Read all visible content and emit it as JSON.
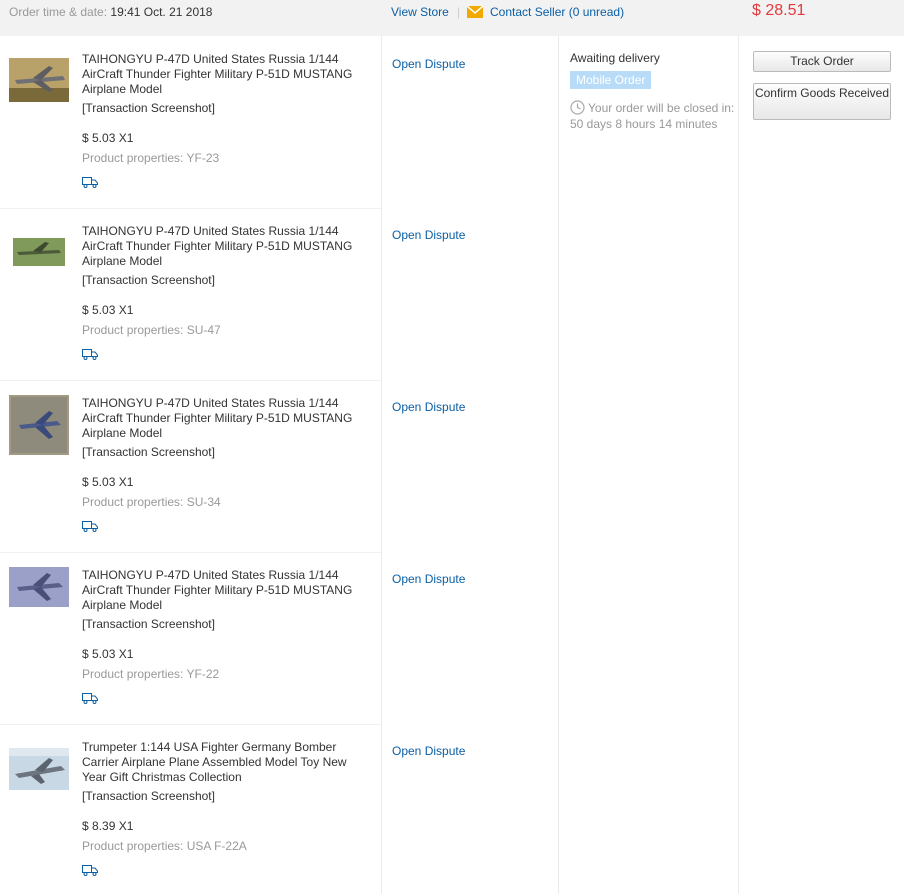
{
  "header": {
    "order_time_label": "Order time & date:",
    "order_time_value": "19:41 Oct. 21 2018",
    "view_store": "View Store",
    "separator": "|",
    "contact_seller": "Contact Seller (0 unread)",
    "total": "$ 28.51"
  },
  "items": [
    {
      "name": "TAIHONGYU P-47D United States Russia 1/144 AirCraft Thunder Fighter Military P-51D MUSTANG Airplane Model",
      "screenshot": "[Transaction Screenshot]",
      "price": "$ 5.03 X1",
      "properties": "Product properties: YF-23",
      "dispute": "Open Dispute",
      "thumb_color": "#8a7a4a"
    },
    {
      "name": "TAIHONGYU P-47D United States Russia 1/144 AirCraft Thunder Fighter Military P-51D MUSTANG Airplane Model",
      "screenshot": "[Transaction Screenshot]",
      "price": "$ 5.03 X1",
      "properties": "Product properties: SU-47",
      "dispute": "Open Dispute",
      "thumb_color": "#6b8a4a"
    },
    {
      "name": "TAIHONGYU P-47D United States Russia 1/144 AirCraft Thunder Fighter Military P-51D MUSTANG Airplane Model",
      "screenshot": "[Transaction Screenshot]",
      "price": "$ 5.03 X1",
      "properties": "Product properties: SU-34",
      "dispute": "Open Dispute",
      "thumb_color": "#7d7a6e"
    },
    {
      "name": "TAIHONGYU P-47D United States Russia 1/144 AirCraft Thunder Fighter Military P-51D MUSTANG Airplane Model",
      "screenshot": "[Transaction Screenshot]",
      "price": "$ 5.03 X1",
      "properties": "Product properties: YF-22",
      "dispute": "Open Dispute",
      "thumb_color": "#7a7fb0"
    },
    {
      "name": "Trumpeter 1:144 USA Fighter Germany Bomber Carrier Airplane Plane Assembled Model Toy New Year Gift Christmas Collection",
      "screenshot": "[Transaction Screenshot]",
      "price": "$ 8.39 X1",
      "properties": "Product properties: USA F-22A",
      "dispute": "Open Dispute",
      "thumb_color": "#9fb6c8"
    }
  ],
  "status": {
    "title": "Awaiting delivery",
    "badge": "Mobile Order",
    "closing": "Your order will be closed in: 50 days 8 hours 14 minutes"
  },
  "actions": {
    "track": "Track Order",
    "confirm": "Confirm Goods Received"
  },
  "colors": {
    "link": "#0b5fa5",
    "price_total": "#e4393c",
    "badge_bg": "#b8dcf8",
    "mail_icon": "#f2a900"
  }
}
